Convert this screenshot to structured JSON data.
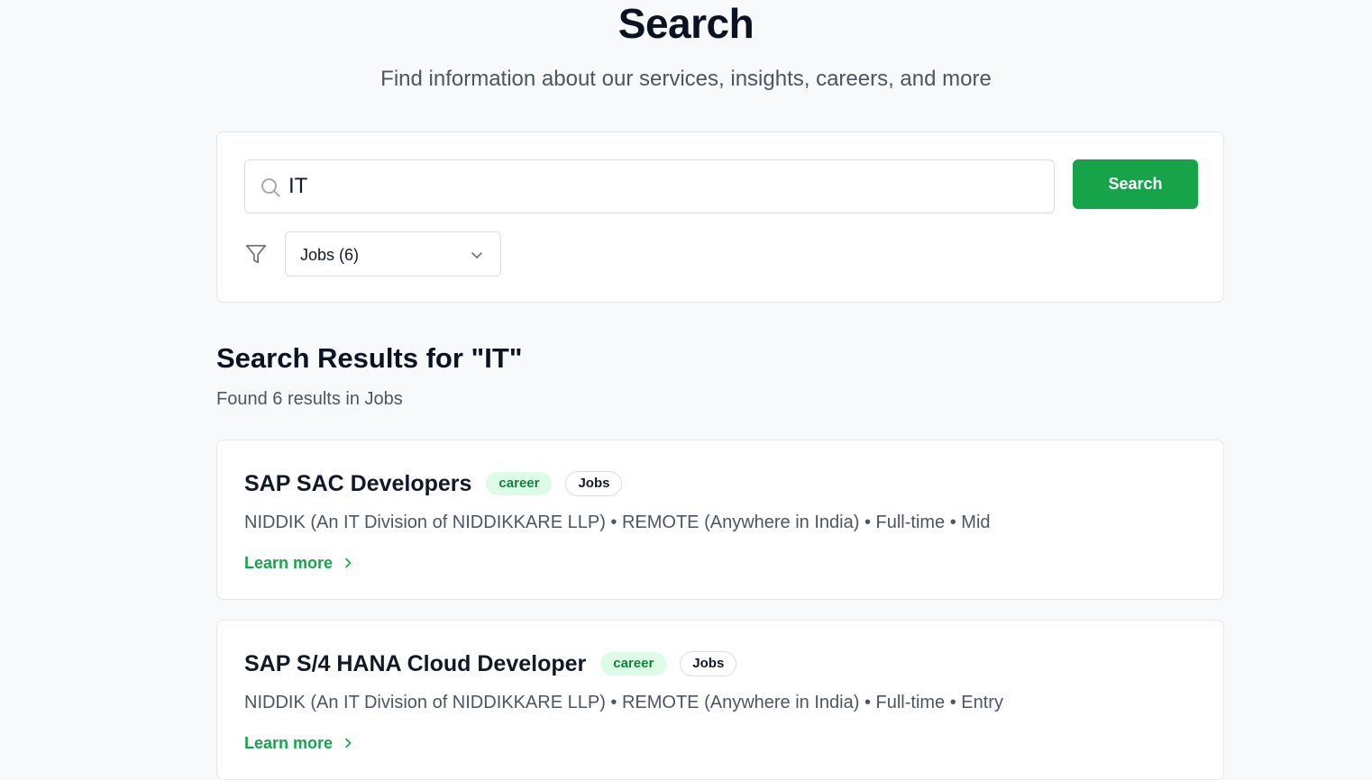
{
  "header": {
    "title": "Search",
    "subtitle": "Find information about our services, insights, careers, and more"
  },
  "search": {
    "query": "IT",
    "button_label": "Search",
    "icon": "search-icon"
  },
  "filter": {
    "icon": "filter-icon",
    "selected": "Jobs (6)"
  },
  "results": {
    "heading": "Search Results for \"IT\"",
    "summary": "Found 6 results in Jobs",
    "items": [
      {
        "title": "SAP SAC Developers",
        "badge_type": "career",
        "badge_category": "Jobs",
        "meta": "NIDDIK (An IT Division of NIDDIKKARE LLP) • REMOTE (Anywhere in India) • Full-time • Mid",
        "link_label": "Learn more"
      },
      {
        "title": "SAP S/4 HANA Cloud Developer",
        "badge_type": "career",
        "badge_category": "Jobs",
        "meta": "NIDDIK (An IT Division of NIDDIKKARE LLP) • REMOTE (Anywhere in India) • Full-time • Entry",
        "link_label": "Learn more"
      }
    ]
  },
  "colors": {
    "accent": "#16a34a",
    "badge_bg": "#dcfce7",
    "page_bg": "#f8f9fb"
  }
}
